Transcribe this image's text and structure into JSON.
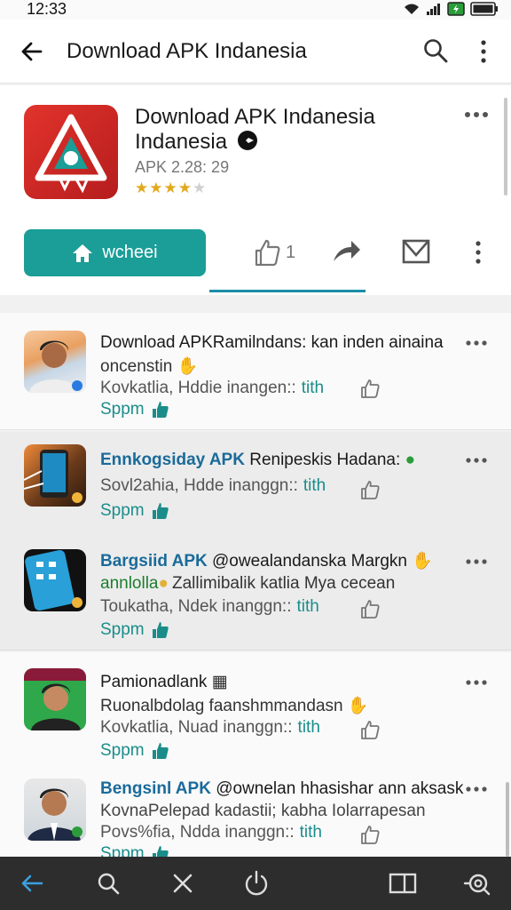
{
  "status": {
    "time": "12:33"
  },
  "app_bar": {
    "title": "Download APK Indanesia"
  },
  "header": {
    "title_line1": "Download APK Indanesia",
    "title_line2": "Indanesia",
    "version": "APK 2.28: 29",
    "rating": 3.5,
    "install_label": "wcheei",
    "like_count": "1",
    "accent_color": "#1a9e97"
  },
  "feed": [
    {
      "title": "Download APKRamilndans: kan inden ainaina",
      "title_accent": "",
      "subtitle": "oncenstin",
      "meta": "Kovkatlia, Hddie inangen::",
      "meta_link": "tith",
      "foot": "Sppm"
    },
    {
      "title_accent": "Ennkogsiday APK",
      "title": "Renipeskis Hadana:",
      "subtitle": "",
      "meta": "Sovl2ahia, Hdde inanggn::",
      "meta_link": "tith",
      "foot": "Sppm"
    },
    {
      "title_accent": "Bargsiid APK",
      "title": "@owealandanska Margkn",
      "subtitle": "annlolla",
      "subtitle2": "Zallimibalik katlia Mya cecean",
      "meta": "Toukatha, Ndek inanggn::",
      "meta_link": "tith",
      "foot": "Sppm"
    },
    {
      "title_accent": "",
      "title": "Pamionadlank",
      "subtitle": "Ruonalbdolag faanshmmandasn",
      "meta": "Kovkatlia, Nuad inanggn::",
      "meta_link": "tith",
      "foot": "Sppm"
    },
    {
      "title_accent": "Bengsinl APK",
      "title": "@ownelan hhasishar ann aksask",
      "subtitle": "KovnaPelepad kadastii; kabha Iolarrapesan",
      "meta": "Povs%fia, Ndda inanggn::",
      "meta_link": "tith",
      "foot": "Sppm"
    }
  ]
}
